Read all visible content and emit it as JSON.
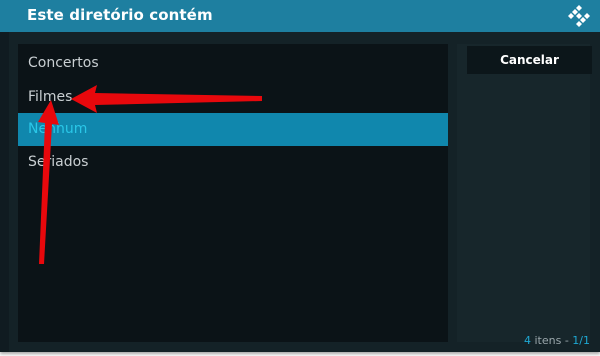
{
  "dialog": {
    "title": "Este diretório contém",
    "logo_icon": "kodi-logo-icon"
  },
  "list": {
    "items": [
      {
        "label": "Concertos"
      },
      {
        "label": "Filmes"
      },
      {
        "label": "Nenhum",
        "selected": true
      },
      {
        "label": "Seriados"
      }
    ]
  },
  "actions": {
    "cancel_label": "Cancelar"
  },
  "footer": {
    "count": "4",
    "items_word": "itens",
    "separator": "-",
    "page": "1/1"
  },
  "annotations": {
    "arrow_color": "#e8080c",
    "arrows": [
      "arrow-right-pointing-left",
      "arrow-bottom-pointing-up"
    ]
  },
  "colors": {
    "header": "#1e7fa0",
    "selected_row": "#1087ad",
    "selected_text": "#2ac7e8",
    "accent": "#1ea8d3"
  }
}
